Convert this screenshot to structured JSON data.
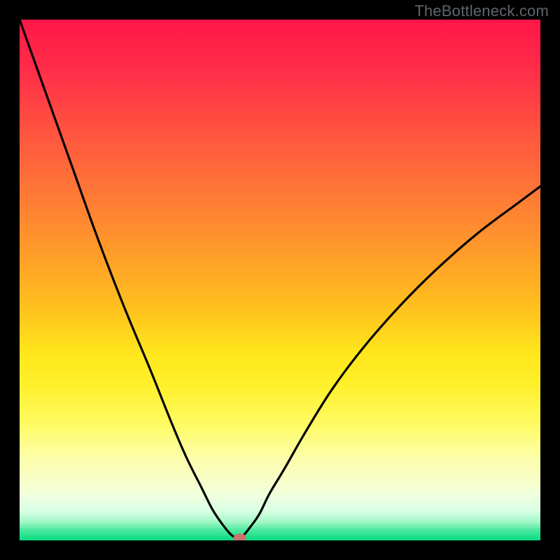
{
  "watermark": "TheBottleneck.com",
  "chart_data": {
    "type": "line",
    "title": "",
    "xlabel": "",
    "ylabel": "",
    "xlim": [
      0,
      100
    ],
    "ylim": [
      0,
      100
    ],
    "grid": false,
    "gradient_stops": [
      {
        "pos": 0,
        "color": "#ff1648"
      },
      {
        "pos": 10,
        "color": "#ff2e49"
      },
      {
        "pos": 22,
        "color": "#ff553f"
      },
      {
        "pos": 34,
        "color": "#ff7a36"
      },
      {
        "pos": 46,
        "color": "#ffa028"
      },
      {
        "pos": 56,
        "color": "#ffc31d"
      },
      {
        "pos": 64,
        "color": "#ffe61b"
      },
      {
        "pos": 70,
        "color": "#fff02a"
      },
      {
        "pos": 78,
        "color": "#fffb66"
      },
      {
        "pos": 84,
        "color": "#fdfea8"
      },
      {
        "pos": 89,
        "color": "#f6ffcd"
      },
      {
        "pos": 92,
        "color": "#ecffe0"
      },
      {
        "pos": 94.5,
        "color": "#d6ffe4"
      },
      {
        "pos": 96.5,
        "color": "#9ff7c4"
      },
      {
        "pos": 98,
        "color": "#4de9a0"
      },
      {
        "pos": 100,
        "color": "#06db82"
      }
    ],
    "series": [
      {
        "name": "bottleneck-curve",
        "x": [
          0,
          5,
          10,
          15,
          20,
          25,
          29,
          32,
          35,
          37,
          39,
          40.5,
          41.5,
          42,
          43,
          44,
          46,
          48,
          51,
          55,
          60,
          66,
          73,
          80,
          88,
          96,
          100
        ],
        "y": [
          100,
          86,
          72,
          58,
          45,
          33,
          23,
          16,
          10,
          6,
          3,
          1.2,
          0.5,
          0.5,
          1.0,
          2.2,
          5,
          9,
          14,
          21,
          29,
          37,
          45,
          52,
          59,
          65,
          68
        ]
      }
    ],
    "marker": {
      "x": 42.3,
      "y": 0.5,
      "color": "#c9746d"
    }
  }
}
